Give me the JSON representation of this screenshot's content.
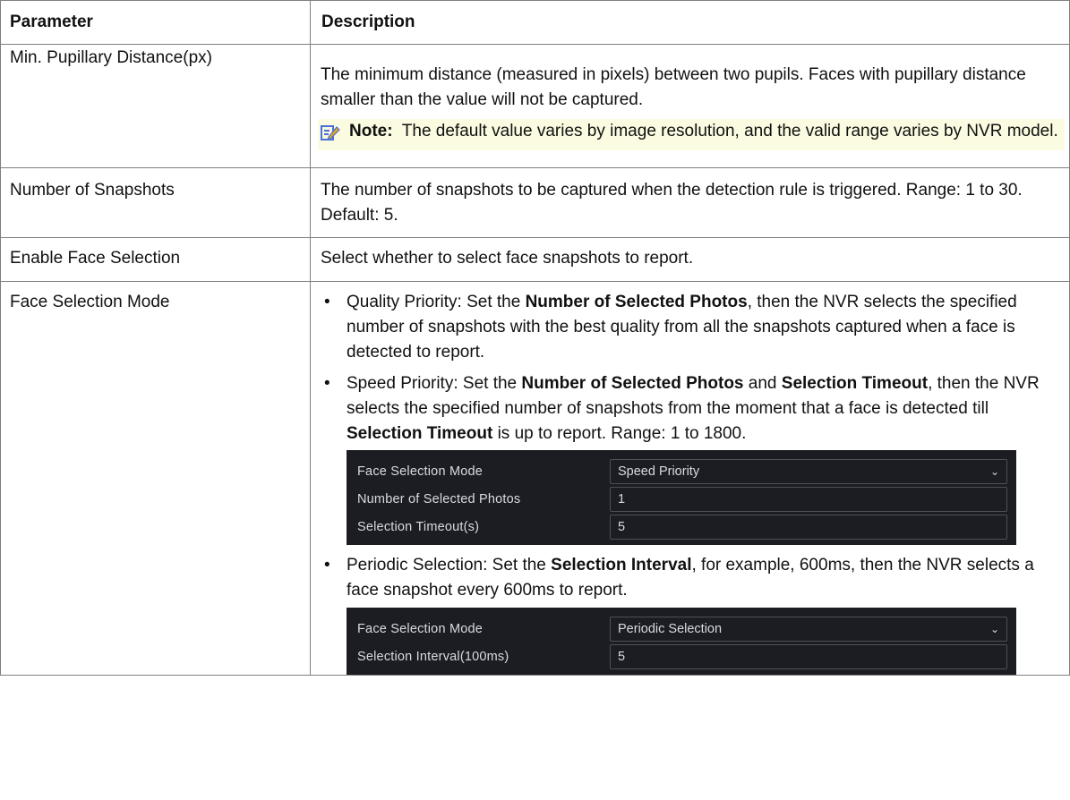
{
  "header": {
    "col1": "Parameter",
    "col2": "Description"
  },
  "rows": {
    "r1": {
      "name": "Min. Pupillary Distance(px)",
      "desc": "The minimum distance (measured in pixels) between two pupils. Faces with pupillary distance smaller than the value will not be captured.",
      "note_label": "Note:",
      "note_text": "The default value varies by image resolution, and the valid range varies by NVR model."
    },
    "r2": {
      "name": "Number of Snapshots",
      "desc": "The number of snapshots to be captured when the detection rule is triggered. Range: 1 to 30. Default: 5."
    },
    "r3": {
      "name": "Enable Face Selection",
      "desc": "Select whether to select face snapshots to report."
    },
    "r4": {
      "name": "Face Selection Mode",
      "b1": {
        "t1": "Quality Priority: Set the ",
        "k1": "Number of Selected Photos",
        "t2": ", then the NVR selects the specified number of snapshots with the best quality from all the snapshots captured when a face is detected to report."
      },
      "b2": {
        "t1": "Speed Priority: Set the ",
        "k1": "Number of Selected Photos",
        "t2": " and ",
        "k2": "Selection Timeout",
        "t3": ", then the NVR selects the specified number of snapshots from the moment that a face is detected till ",
        "k3": "Selection Timeout",
        "t4": " is up to report. Range: 1 to 1800."
      },
      "shot1": {
        "mode_label": "Face Selection Mode",
        "mode_value": "Speed Priority",
        "photos_label": "Number of Selected Photos",
        "photos_value": "1",
        "timeout_label": "Selection Timeout(s)",
        "timeout_value": "5"
      },
      "b3": {
        "t1": "Periodic Selection: Set the ",
        "k1": "Selection Interval",
        "t2": ", for example, 600ms, then the NVR selects a face snapshot every 600ms to report."
      },
      "shot2": {
        "mode_label": "Face Selection Mode",
        "mode_value": "Periodic Selection",
        "interval_label": "Selection Interval(100ms)",
        "interval_value": "5"
      }
    }
  },
  "icons": {
    "note": "note-pencil-icon",
    "chevron": "chevron-down-icon"
  },
  "colors": {
    "note_bg": "#fbfbe1",
    "note_icon": "#4a6fd6",
    "dark_panel": "#1b1d22"
  }
}
